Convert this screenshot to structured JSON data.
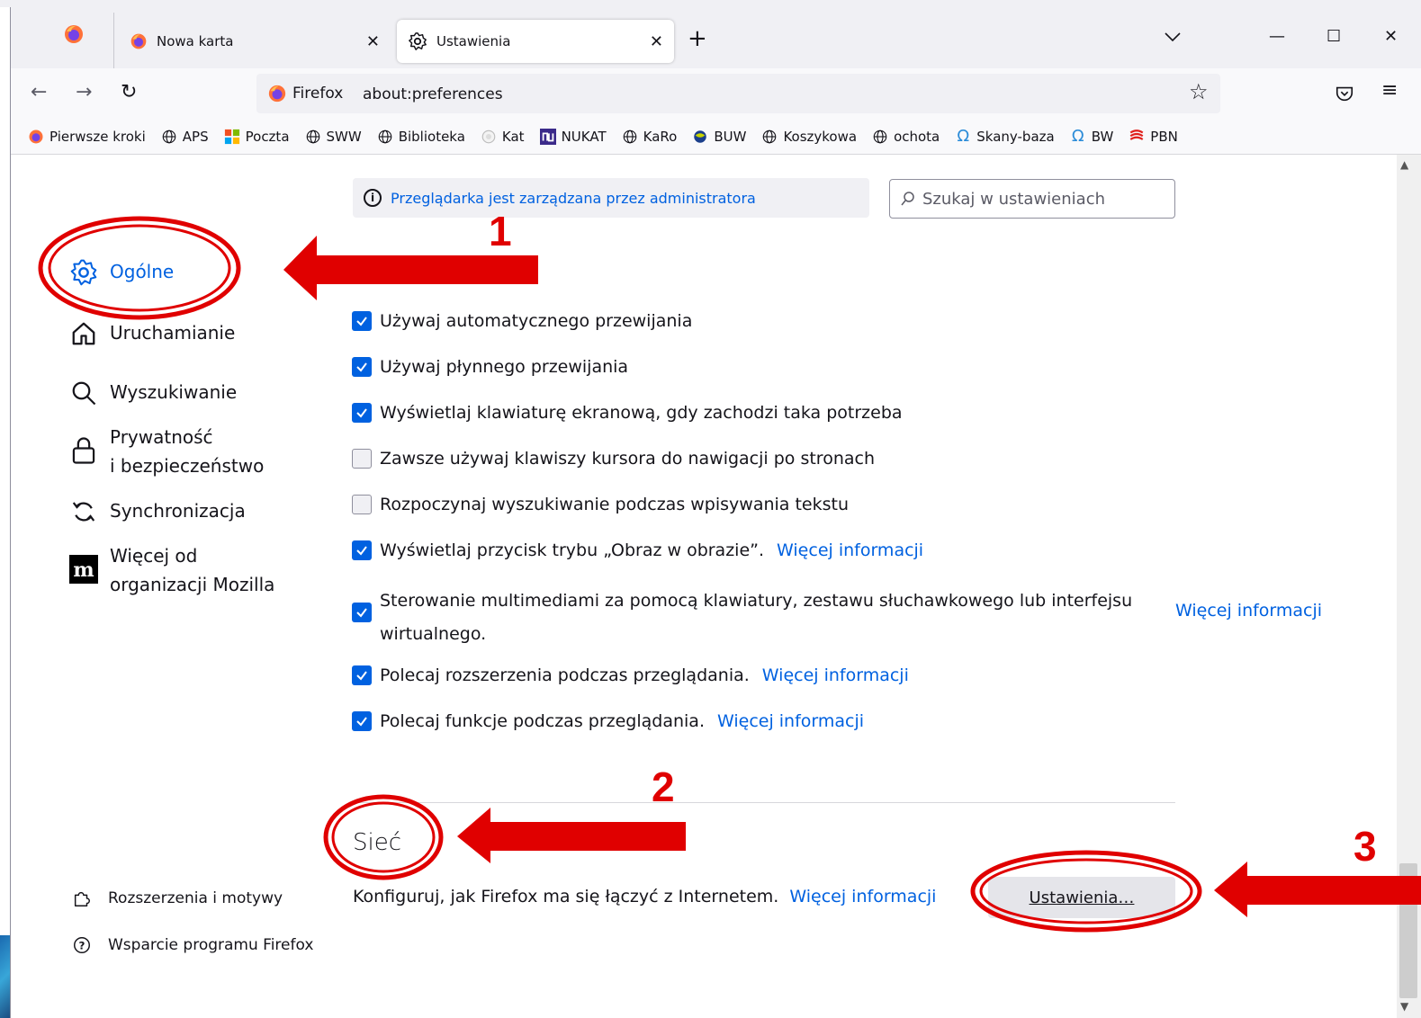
{
  "tabs": {
    "inactive": {
      "label": "Nowa karta"
    },
    "active": {
      "label": "Ustawienia"
    },
    "close_glyph": "✕",
    "newtab_glyph": "+",
    "tablist_glyph": "⌄"
  },
  "window": {
    "minimize": "—",
    "maximize": "☐",
    "close": "✕"
  },
  "urlbar": {
    "identity_label": "Firefox",
    "url": "about:preferences"
  },
  "bookmarks": [
    {
      "label": "Pierwsze kroki",
      "icon": "firefox-icon"
    },
    {
      "label": "APS",
      "icon": "globe-icon"
    },
    {
      "label": "Poczta",
      "icon": "windows-icon"
    },
    {
      "label": "SWW",
      "icon": "globe-icon"
    },
    {
      "label": "Biblioteka",
      "icon": "globe-icon"
    },
    {
      "label": "Kat",
      "icon": "puzzle-globe-icon"
    },
    {
      "label": "NUKAT",
      "icon": "nukat-icon"
    },
    {
      "label": "KaRo",
      "icon": "globe-icon"
    },
    {
      "label": "BUW",
      "icon": "buw-icon"
    },
    {
      "label": "Koszykowa",
      "icon": "globe-icon"
    },
    {
      "label": "ochota",
      "icon": "globe-icon"
    },
    {
      "label": "Skany-baza",
      "icon": "omega-icon"
    },
    {
      "label": "BW",
      "icon": "omega-icon"
    },
    {
      "label": "PBN",
      "icon": "pbn-icon"
    }
  ],
  "managed_notice": "Przeglądarka jest zarządzana przez administratora",
  "search": {
    "placeholder": "Szukaj w ustawieniach"
  },
  "sidebar": {
    "categories": [
      {
        "label": "Ogólne",
        "selected": true
      },
      {
        "label": "Uruchamianie"
      },
      {
        "label": "Wyszukiwanie"
      },
      {
        "label": "Prywatność",
        "label2": "i bezpieczeństwo"
      },
      {
        "label": "Synchronizacja"
      },
      {
        "label": "Więcej od",
        "label2": "organizacji Mozilla"
      }
    ],
    "footer": [
      {
        "label": "Rozszerzenia i motywy"
      },
      {
        "label": "Wsparcie programu Firefox"
      }
    ]
  },
  "options": [
    {
      "label": "Używaj automatycznego przewijania",
      "checked": true
    },
    {
      "label": "Używaj płynnego przewijania",
      "checked": true
    },
    {
      "label": "Wyświetlaj klawiaturę ekranową, gdy zachodzi taka potrzeba",
      "checked": true
    },
    {
      "label": "Zawsze używaj klawiszy kursora do nawigacji po stronach",
      "checked": false
    },
    {
      "label": "Rozpoczynaj wyszukiwanie podczas wpisywania tekstu",
      "checked": false
    },
    {
      "label": "Wyświetlaj przycisk trybu „Obraz w obrazie”.",
      "checked": true,
      "link": "Więcej informacji"
    },
    {
      "label": "Sterowanie multimediami za pomocą klawiatury, zestawu słuchawkowego lub interfejsu wirtualnego.",
      "checked": true,
      "link": "Więcej informacji"
    },
    {
      "label": "Polecaj rozszerzenia podczas przeglądania.",
      "checked": true,
      "link": "Więcej informacji"
    },
    {
      "label": "Polecaj funkcje podczas przeglądania.",
      "checked": true,
      "link": "Więcej informacji"
    }
  ],
  "network": {
    "title": "Sieć",
    "description": "Konfiguruj, jak Firefox ma się łączyć z Internetem.",
    "link": "Więcej informacji",
    "button": "Ustawienia…"
  },
  "annotations": {
    "step1": "1",
    "step2": "2",
    "step3": "3",
    "color": "#e00000"
  },
  "colors": {
    "accent": "#0061e0",
    "chrome_bg": "#f0f0f4",
    "text": "#15141a"
  }
}
